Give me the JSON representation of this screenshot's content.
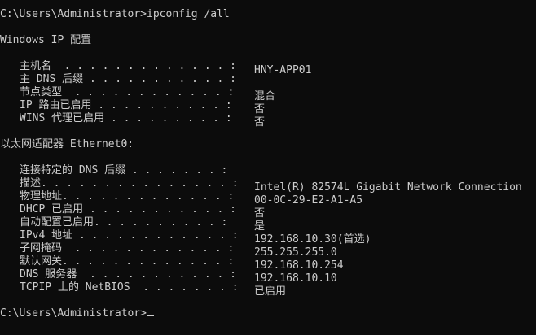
{
  "terminal": {
    "colors": {
      "background": "#0c0c0c",
      "foreground": "#cccccc"
    },
    "command_line": "C:\\Users\\Administrator>ipconfig /all",
    "windows_ip_header": "Windows IP 配置",
    "windows_ip_config": [
      {
        "label": "主机名  . . . . . . . . . . . . . :",
        "value": "HNY-APP01"
      },
      {
        "label": "主 DNS 后缀 . . . . . . . . . . . :",
        "value": ""
      },
      {
        "label": "节点类型  . . . . . . . . . . . . :",
        "value": "混合"
      },
      {
        "label": "IP 路由已启用 . . . . . . . . . . :",
        "value": "否"
      },
      {
        "label": "WINS 代理已启用 . . . . . . . . . :",
        "value": "否"
      }
    ],
    "adapter_header": "以太网适配器 Ethernet0:",
    "adapter_config": [
      {
        "label": "连接特定的 DNS 后缀 . . . . . . . :",
        "value": ""
      },
      {
        "label": "描述. . . . . . . . . . . . . . . :",
        "value": "Intel(R) 82574L Gigabit Network Connection"
      },
      {
        "label": "物理地址. . . . . . . . . . . . . :",
        "value": "00-0C-29-E2-A1-A5"
      },
      {
        "label": "DHCP 已启用 . . . . . . . . . . . :",
        "value": "否"
      },
      {
        "label": "自动配置已启用. . . . . . . . . . :",
        "value": "是"
      },
      {
        "label": "IPv4 地址 . . . . . . . . . . . . :",
        "value": "192.168.10.30(首选)"
      },
      {
        "label": "子网掩码  . . . . . . . . . . . . :",
        "value": "255.255.255.0"
      },
      {
        "label": "默认网关. . . . . . . . . . . . . :",
        "value": "192.168.10.254"
      },
      {
        "label": "DNS 服务器  . . . . . . . . . . . :",
        "value": "192.168.10.10"
      },
      {
        "label": "TCPIP 上的 NetBIOS  . . . . . . . :",
        "value": "已启用"
      }
    ],
    "prompt": "C:\\Users\\Administrator>"
  }
}
